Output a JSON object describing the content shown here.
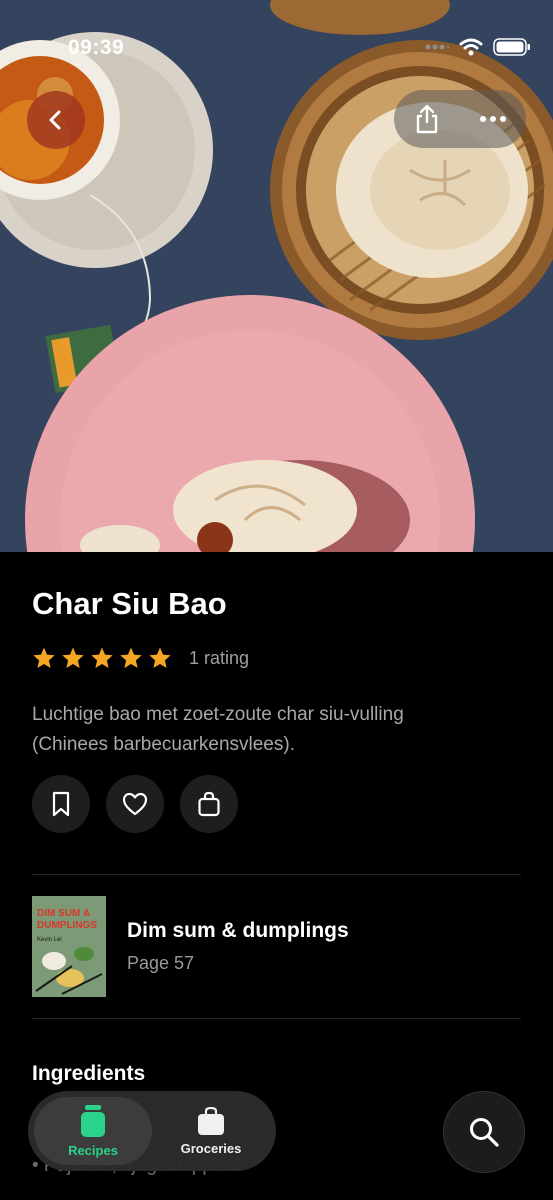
{
  "status_bar": {
    "time": "09:39"
  },
  "recipe": {
    "title": "Char Siu Bao",
    "rating": 5,
    "rating_text": "1 rating",
    "description_lines": [
      "Luchtige bao met zoet-zoute char siu-vulling",
      "(Chinees barbecuarkensvlees)."
    ]
  },
  "book": {
    "title": "Dim sum & dumplings",
    "page": "Page 57",
    "cover_title_line1": "DIM SUM &",
    "cover_title_line2": "DUMPLINGS",
    "cover_author": "Kevin Lei"
  },
  "sections": {
    "ingredients_heading": "Ingredients",
    "first_ingredient_peek": "• Pajaiste, fijngesnipperd"
  },
  "tabbar": {
    "tabs": [
      {
        "label": "Recipes",
        "icon": "jar-icon",
        "active": true
      },
      {
        "label": "Groceries",
        "icon": "shopping-bag-icon",
        "active": false
      }
    ]
  },
  "colors": {
    "accent_green": "#2ad28a",
    "star": "#f5a623",
    "back_button": "#a0371e"
  },
  "icons": [
    "chevron-left-icon",
    "share-icon",
    "more-icon",
    "bookmark-icon",
    "heart-icon",
    "shopping-bag-icon",
    "search-icon",
    "wifi-icon",
    "battery-icon",
    "signal-icon"
  ]
}
